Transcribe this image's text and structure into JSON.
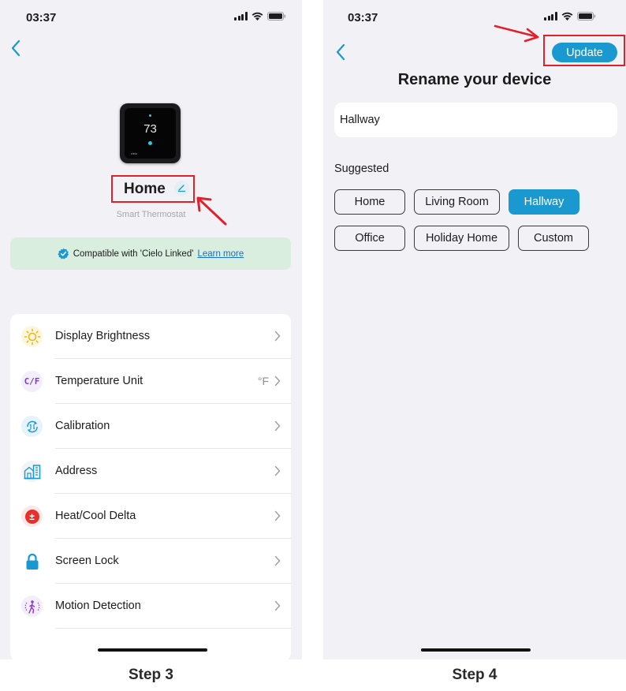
{
  "steps": {
    "left": "Step 3",
    "right": "Step 4"
  },
  "status_bar": {
    "time": "03:37"
  },
  "device": {
    "name": "Home",
    "type": "Smart Thermostat",
    "display_temp": "73",
    "brand_mark": "cielo"
  },
  "compat": {
    "text": "Compatible with 'Cielo Linked'",
    "link": "Learn more",
    "color": "#d9eede"
  },
  "settings": [
    {
      "label": "Display Brightness",
      "value": "",
      "icon": "sun-icon"
    },
    {
      "label": "Temperature Unit",
      "value": "°F",
      "icon": "cf-icon"
    },
    {
      "label": "Calibration",
      "value": "",
      "icon": "calibration-icon"
    },
    {
      "label": "Address",
      "value": "",
      "icon": "address-icon"
    },
    {
      "label": "Heat/Cool Delta",
      "value": "",
      "icon": "plus-minus-icon"
    },
    {
      "label": "Screen Lock",
      "value": "",
      "icon": "lock-icon"
    },
    {
      "label": "Motion Detection",
      "value": "",
      "icon": "motion-icon"
    }
  ],
  "cf_glyph": "C/F",
  "pm_glyph": "±",
  "rename": {
    "update_label": "Update",
    "title": "Rename your device",
    "input_value": "Hallway",
    "suggested_label": "Suggested",
    "suggestions": [
      "Home",
      "Living Room",
      "Hallway",
      "Office",
      "Holiday Home",
      "Custom"
    ],
    "selected": "Hallway"
  },
  "colors": {
    "accent": "#1a98d0",
    "annotation_red": "#e0202a",
    "background": "#f2f1f6"
  }
}
